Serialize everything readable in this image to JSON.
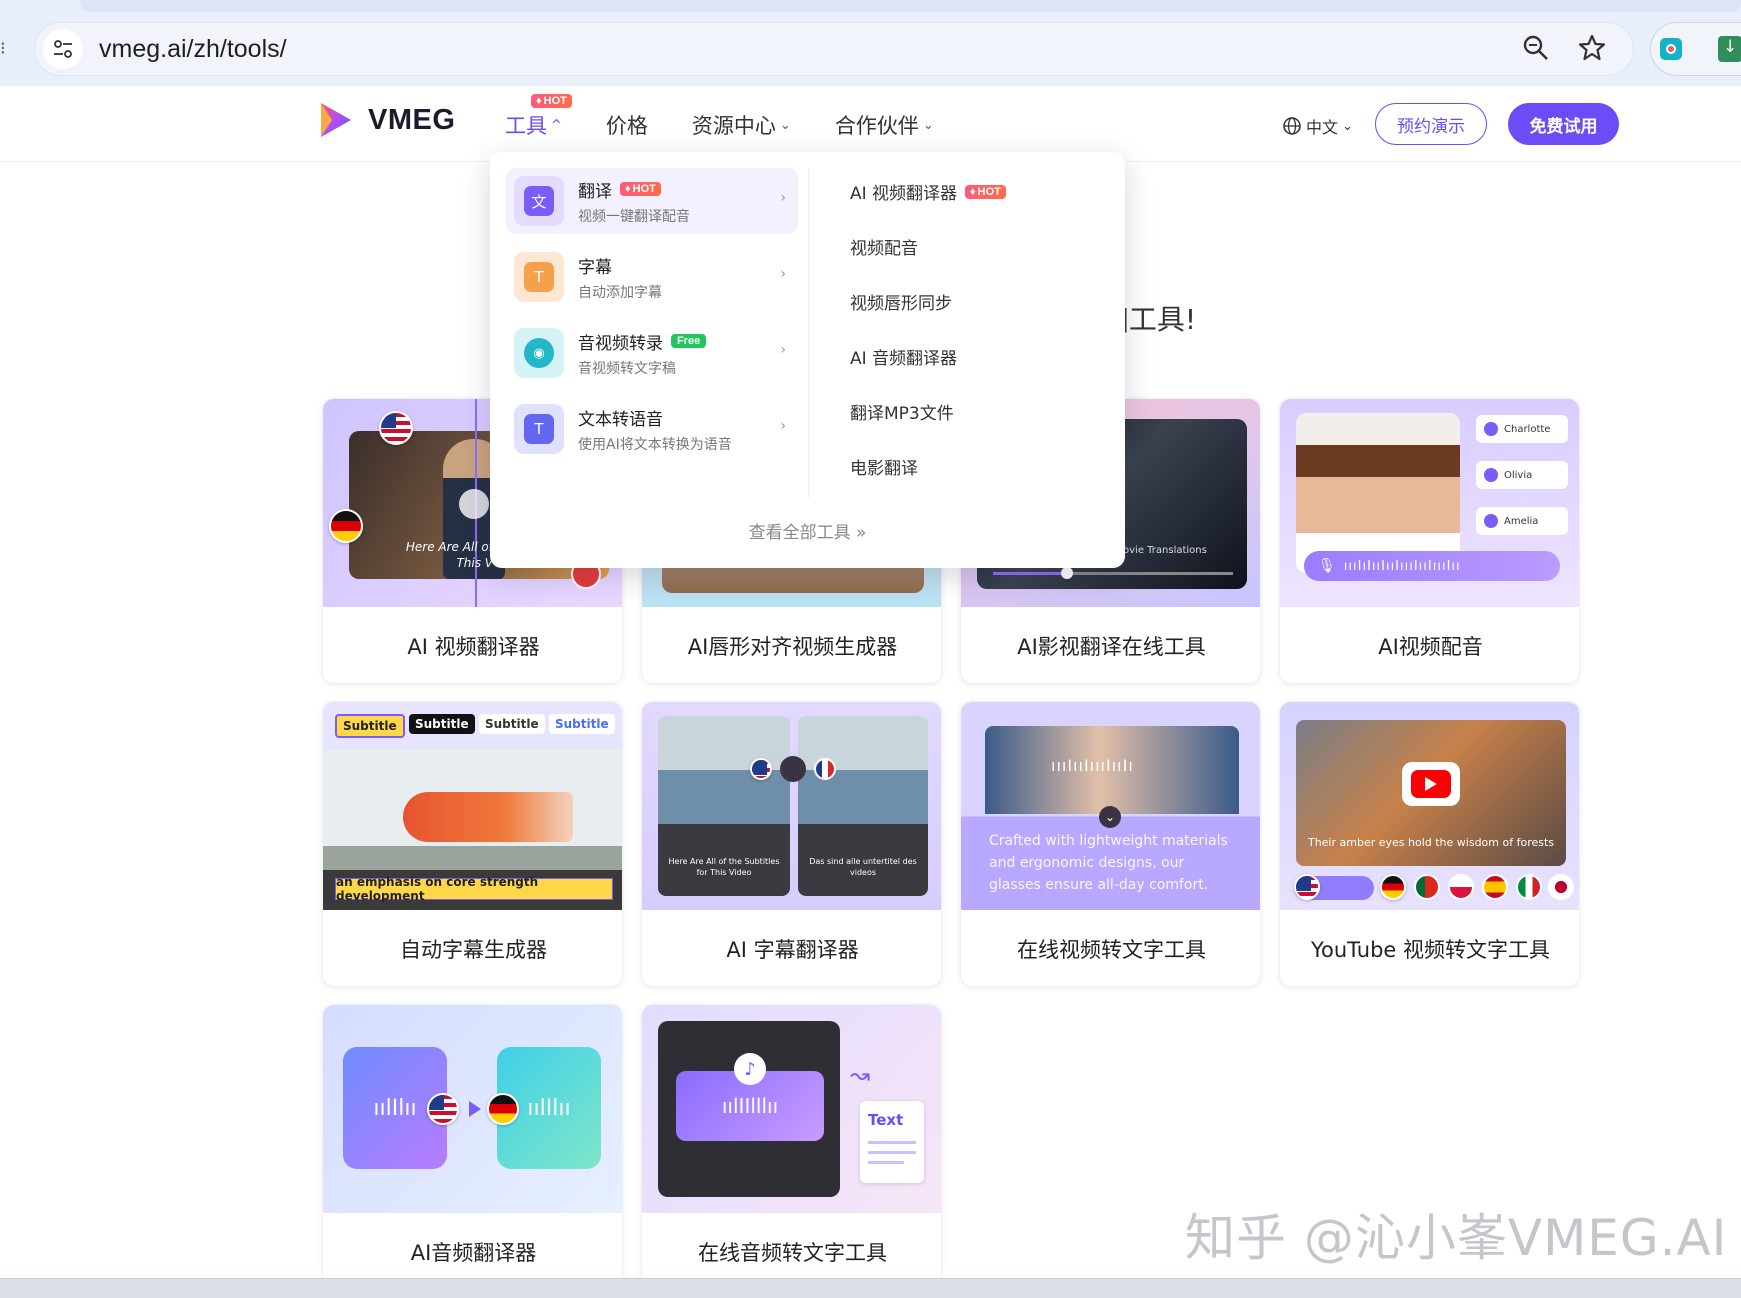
{
  "browser": {
    "url": "vmeg.ai/zh/tools/",
    "left_edge_glyph": "⁝"
  },
  "header": {
    "logo_text": "VMEG",
    "nav": [
      {
        "label": "工具",
        "badge": "HOT",
        "chevron": "^"
      },
      {
        "label": "价格"
      },
      {
        "label": "资源中心",
        "chevron": "⌄"
      },
      {
        "label": "合作伙伴",
        "chevron": "⌄"
      }
    ],
    "lang_label": "中文",
    "demo_label": "预约演示",
    "free_label": "免费试用"
  },
  "hero": {
    "fragment": "]工具!"
  },
  "dropdown": {
    "left_items": [
      {
        "title": "翻译",
        "badge": "HOT",
        "subtitle": "视频一键翻译配音",
        "icon": "translate-icon",
        "color": "#7b5cf6",
        "bg": "#e9e3ff"
      },
      {
        "title": "字幕",
        "subtitle": "自动添加字幕",
        "icon": "subtitle-icon",
        "color": "#f59e3b",
        "bg": "#fde9d6"
      },
      {
        "title": "音视频转录",
        "badge": "Free",
        "subtitle": "音视频转文字稿",
        "icon": "transcribe-icon",
        "color": "#22b8c8",
        "bg": "#d8f3f6"
      },
      {
        "title": "文本转语音",
        "subtitle": "使用AI将文本转换为语音",
        "icon": "tts-icon",
        "color": "#6366f1",
        "bg": "#e2e4fc"
      }
    ],
    "right_items": [
      {
        "label": "AI 视频翻译器",
        "badge": "HOT"
      },
      {
        "label": "视频配音"
      },
      {
        "label": "视频唇形同步"
      },
      {
        "label": "AI 音频翻译器"
      },
      {
        "label": "翻译MP3文件"
      },
      {
        "label": "电影翻译"
      }
    ],
    "view_all": "查看全部工具  »"
  },
  "cards": [
    {
      "title": "AI 视频翻译器",
      "caption": "Here Are All of This V"
    },
    {
      "title": "AI唇形对齐视频生成器"
    },
    {
      "title": "AI影视翻译在线工具",
      "caption": "ovie Translations"
    },
    {
      "title": "AI视频配音",
      "voices": [
        "Charlotte",
        "Olivia",
        "Amelia"
      ]
    },
    {
      "title": "自动字幕生成器",
      "chips": [
        "Subtitle",
        "Subtitle",
        "Subtitle",
        "Subtitle"
      ],
      "caption": "an emphasis on core strength development"
    },
    {
      "title": "AI 字幕翻译器",
      "caption_left": "Here Are All of the Subtitles for This Video",
      "caption_right": "Das sind alle untertitel des videos"
    },
    {
      "title": "在线视频转文字工具",
      "caption": "Crafted with lightweight materials and ergonomic designs, our glasses ensure all-day comfort. Blue-light"
    },
    {
      "title": "YouTube 视频转文字工具",
      "caption": "Their amber eyes hold the wisdom of forests"
    },
    {
      "title": "AI音频翻译器"
    },
    {
      "title": "在线音频转文字工具",
      "doc_text": "Text"
    }
  ],
  "watermark": "知乎 @沁小峯VMEG.AI",
  "colors": {
    "accent": "#6b4cf6",
    "hot": "#ff5a7a",
    "free": "#22c55e"
  }
}
